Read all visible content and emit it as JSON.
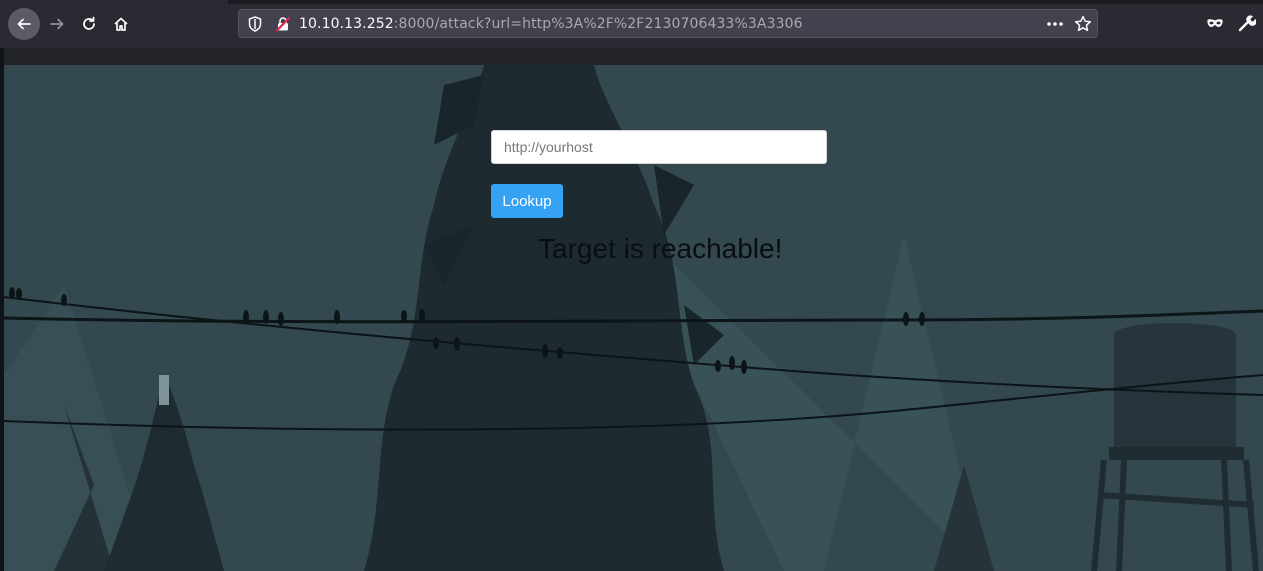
{
  "browser": {
    "url_host": "10.10.13.252",
    "url_rest": ":8000/attack?url=http%3A%2F%2F2130706433%3A3306",
    "icons": {
      "back": "back-arrow-icon",
      "forward": "forward-arrow-icon",
      "reload": "reload-icon",
      "home": "home-icon",
      "tracking": "shield-icon",
      "insecure": "insecure-lock-icon",
      "page_actions": "ellipsis-icon",
      "bookmark": "star-icon",
      "private": "mask-icon",
      "devtools": "wrench-icon"
    }
  },
  "page": {
    "input_placeholder": "http://yourhost",
    "input_value": "",
    "lookup_label": "Lookup",
    "result_text": "Target is reachable!",
    "colors": {
      "button_bg": "#35a2f4",
      "toolbar_bg": "#2b2a33"
    }
  }
}
